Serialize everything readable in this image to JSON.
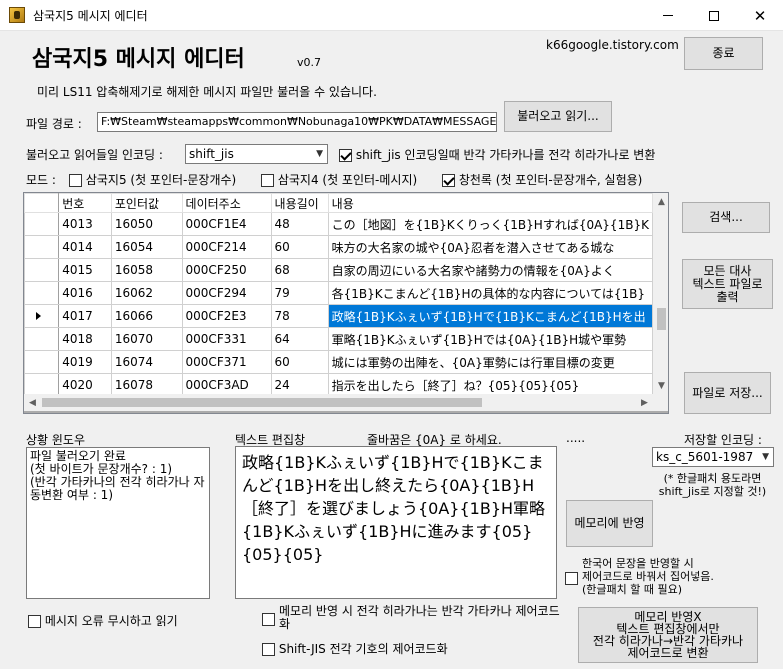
{
  "window": {
    "title": "삼국지5 메시지 에디터",
    "min_icon": "minimize-icon",
    "max_icon": "maximize-icon",
    "close_icon": "close-icon"
  },
  "header": {
    "app_title": "삼국지5 메시지 에디터",
    "version": "v0.7",
    "website": "k66google.tistory.com",
    "notice": "미리 LS11 압축해제기로 해제한 메시지 파일만 불러올 수 있습니다.",
    "exit_label": "종료"
  },
  "file": {
    "path_label": "파일 경로 :",
    "path_value": "F:₩Steam₩steamapps₩common₩Nobunaga10₩PK₩DATA₩MESSAGE",
    "load_label": "불러오고 읽기..."
  },
  "encoding": {
    "label": "불러오고 읽어들일 인코딩 :",
    "value": "shift_jis",
    "kana_convert_label": "shift_jis 인코딩일때 반각 가타카나를 전각 히라가나로 변환",
    "kana_convert_checked": true
  },
  "mode": {
    "label": "모드 :",
    "options": [
      {
        "label": "삼국지5 (첫 포인터-문장개수)",
        "checked": false
      },
      {
        "label": "삼국지4 (첫 포인터-메시지)",
        "checked": false
      },
      {
        "label": "창천록 (첫 포인터-문장개수, 실험용)",
        "checked": true
      }
    ]
  },
  "table": {
    "columns": [
      "번호",
      "포인터값",
      "데이터주소",
      "내용길이",
      "내용"
    ],
    "rows": [
      {
        "num": "4013",
        "ptr": "16050",
        "addr": "000CF1E4",
        "len": "48",
        "content": "この［地図］を{1B}Kくりっく{1B}Hすれば{0A}{1B}K"
      },
      {
        "num": "4014",
        "ptr": "16054",
        "addr": "000CF214",
        "len": "60",
        "content": "味方の大名家の城や{0A}忍者を潜入させてある城な"
      },
      {
        "num": "4015",
        "ptr": "16058",
        "addr": "000CF250",
        "len": "68",
        "content": "自家の周辺にいる大名家や諸勢力の情報を{0A}よく"
      },
      {
        "num": "4016",
        "ptr": "16062",
        "addr": "000CF294",
        "len": "79",
        "content": "各{1B}Kこまんど{1B}Hの具体的な内容については{1B}"
      },
      {
        "num": "4017",
        "ptr": "16066",
        "addr": "000CF2E3",
        "len": "78",
        "content": "政略{1B}Kふぇいず{1B}Hで{1B}Kこまんど{1B}Hを出"
      },
      {
        "num": "4018",
        "ptr": "16070",
        "addr": "000CF331",
        "len": "64",
        "content": "軍略{1B}Kふぇいず{1B}Hでは{0A}{1B}H城や軍勢"
      },
      {
        "num": "4019",
        "ptr": "16074",
        "addr": "000CF371",
        "len": "60",
        "content": "城には軍勢の出陣を、{0A}軍勢には行軍目標の変更"
      },
      {
        "num": "4020",
        "ptr": "16078",
        "addr": "000CF3AD",
        "len": "24",
        "content": "指示を出したら［終了］ね？{05}{05}{05}"
      }
    ],
    "selected_row": 4
  },
  "side_buttons": {
    "search": "검색...",
    "export": "모든 대사\n텍스트 파일로\n출력",
    "save": "파일로 저장..."
  },
  "status": {
    "label": "상황 윈도우",
    "text": "파일 불러오기 완료\n(첫 바이트가 문장개수? : 1)\n(반각 가타카나의 전각 히라가나 자동변환 여부 : 1)"
  },
  "editor": {
    "label": "텍스트 편집창",
    "hint": "줄바꿈은 {0A} 로 하세요.",
    "dots": ".....",
    "text": "政略{1B}Kふぇいず{1B}Hで{1B}Kこまんど{1B}Hを出し終えたら{0A}{1B}H［終了］を選びましょう{0A}{1B}H軍略{1B}Kふぇいず{1B}Hに進みます{05}{05}{05}"
  },
  "save_encoding": {
    "label": "저장할 인코딩 :",
    "value": "ks_c_5601-1987",
    "note": "(* 한글패치 용도라면\nshift_jis로 지정할 것!)"
  },
  "actions": {
    "apply_memory": "메모리에 반영",
    "korean_ctrl_label": "한국어 문장을 반영할 시\n제어코드로 바꿔서 집어넣음.\n(한글패치 할 때 필요)",
    "korean_ctrl_checked": false,
    "ignore_errors_label": "메시지 오류 무시하고 읽기",
    "ignore_errors_checked": false,
    "hira_to_kata_label": "메모리 반영 시 전각 히라가나는 반각 가타카나 제어코드화",
    "hira_to_kata_checked": false,
    "sjis_symbol_label": "Shift-JIS 전각 기호의 제어코드화",
    "sjis_symbol_checked": false,
    "apply_no_editor": "메모리 반영X\n텍스트 편집창에서만\n전각 히라가나→반각 가타카나\n제어코드로 변환"
  }
}
